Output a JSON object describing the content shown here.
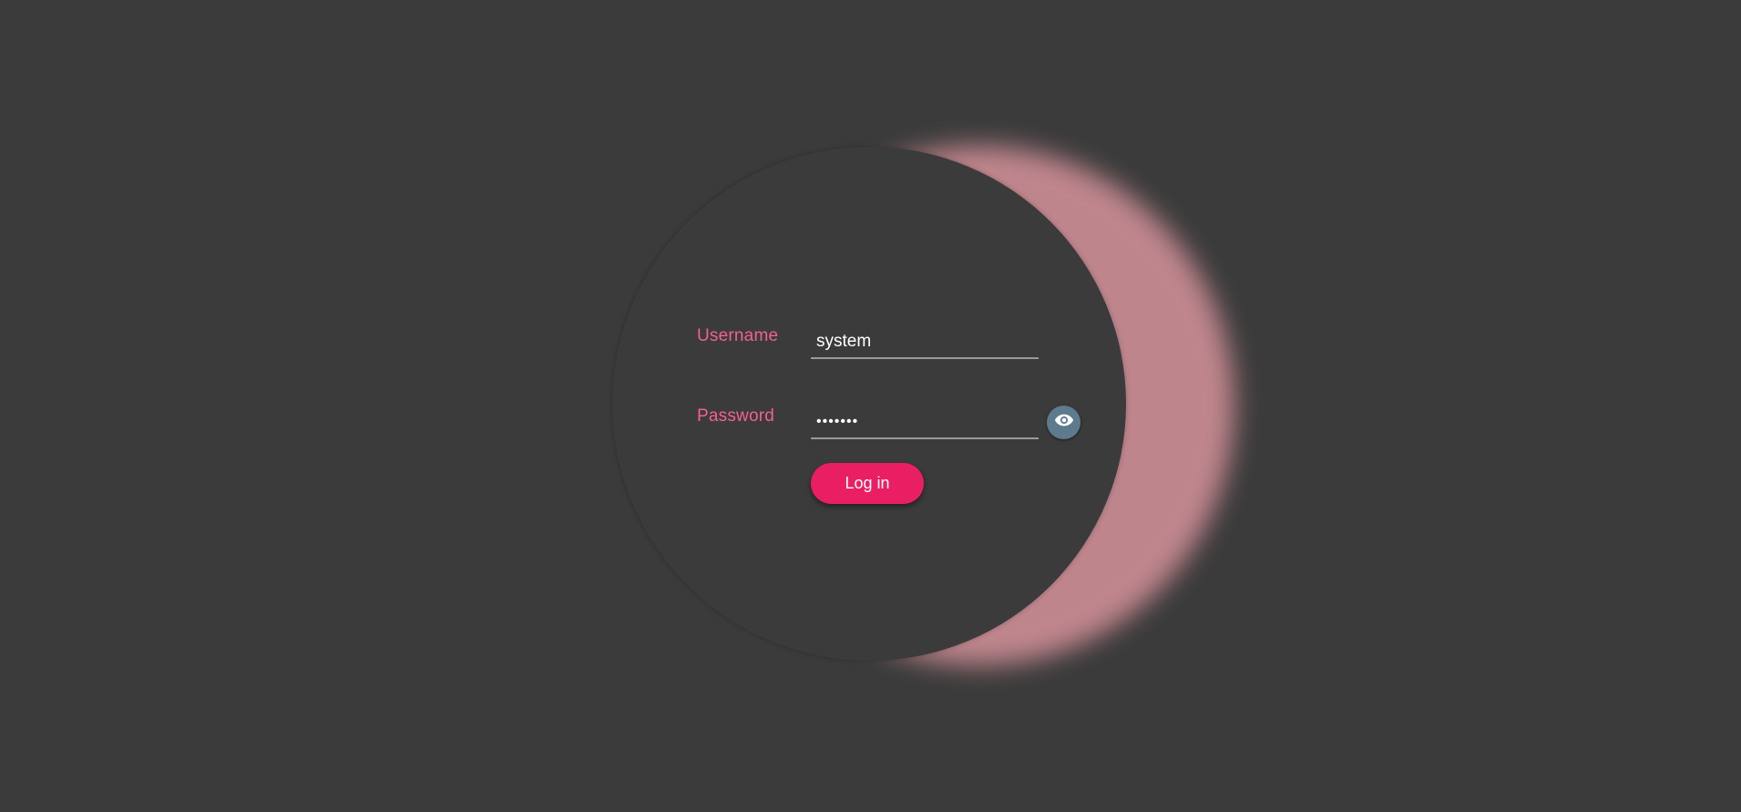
{
  "login": {
    "username_label": "Username",
    "username_value": "system",
    "password_label": "Password",
    "password_value": "•••••••",
    "show_password_icon": "eye-icon",
    "login_button": "Log in"
  },
  "colors": {
    "background": "#3b3b3b",
    "label": "#f0628f",
    "accent": "#e91e63",
    "glow": "#c78a92",
    "eye_button": "#5d7b8c"
  }
}
